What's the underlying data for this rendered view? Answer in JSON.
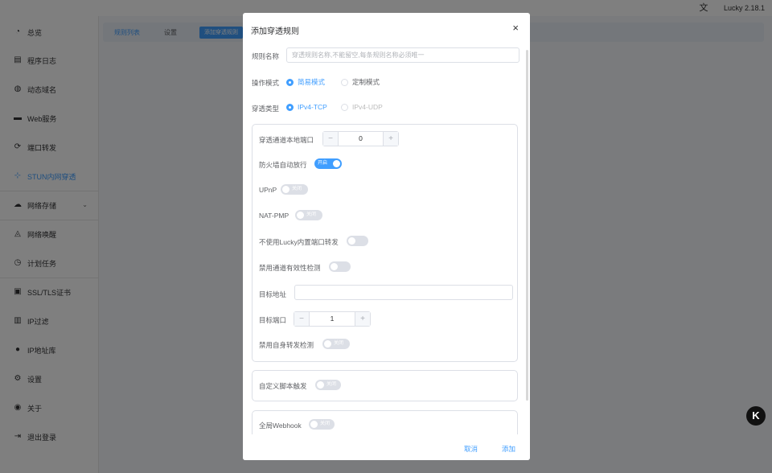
{
  "topbar": {
    "lang_icon": "translate-icon",
    "version": "Lucky 2.18.1"
  },
  "sidebar": {
    "items": [
      {
        "label": "总览",
        "icon": "dashboard-icon"
      },
      {
        "label": "程序日志",
        "icon": "log-icon"
      },
      {
        "label": "动态域名",
        "icon": "globe-icon"
      },
      {
        "label": "Web服务",
        "icon": "web-icon"
      },
      {
        "label": "端口转发",
        "icon": "forward-icon"
      },
      {
        "label": "STUN内网穿透",
        "icon": "stun-icon"
      },
      {
        "label": "网络存储",
        "icon": "cloud-icon"
      },
      {
        "label": "网络唤醒",
        "icon": "bell-icon"
      },
      {
        "label": "计划任务",
        "icon": "clock-icon"
      },
      {
        "label": "SSL/TLS证书",
        "icon": "certificate-icon"
      },
      {
        "label": "IP过滤",
        "icon": "filter-icon"
      },
      {
        "label": "IP地址库",
        "icon": "person-icon"
      },
      {
        "label": "设置",
        "icon": "gear-icon"
      },
      {
        "label": "关于",
        "icon": "info-icon"
      },
      {
        "label": "退出登录",
        "icon": "logout-icon"
      }
    ]
  },
  "tabs": {
    "rules": "规则列表",
    "settings": "设置",
    "add": "添加穿透规则"
  },
  "dialog": {
    "title": "添加穿透规则",
    "close": "×",
    "name_label": "规则名称",
    "name_placeholder": "穿透规则名称,不能留空,每条规则名称必须唯一",
    "mode_label": "操作模式",
    "mode_simple": "简易模式",
    "mode_custom": "定制模式",
    "type_label": "穿透类型",
    "type_tcp": "IPv4-TCP",
    "type_udp": "IPv4-UDP",
    "local_port_label": "穿透通道本地端口",
    "local_port_value": "0",
    "firewall_label": "防火墙自动放行",
    "firewall_state": "开启",
    "upnp_label": "UPnP",
    "upnp_state": "关闭",
    "natpmp_label": "NAT-PMP",
    "natpmp_state": "关闭",
    "no_lucky_label": "不使用Lucky内置端口转发",
    "disable_check_label": "禁用通道有效性检测",
    "target_addr_label": "目标地址",
    "target_port_label": "目标端口",
    "target_port_value": "1",
    "disable_self_label": "禁用自身转发检测",
    "disable_self_state": "关闭",
    "custom_script_label": "自定义脚本触发",
    "custom_script_state": "关闭",
    "webhook_label": "全局Webhook",
    "webhook_state": "关闭",
    "cancel": "取消",
    "add": "添加"
  },
  "corner_badge": "K",
  "colors": {
    "accent": "#409eff",
    "overlay": "rgba(0,0,0,0.5)"
  }
}
